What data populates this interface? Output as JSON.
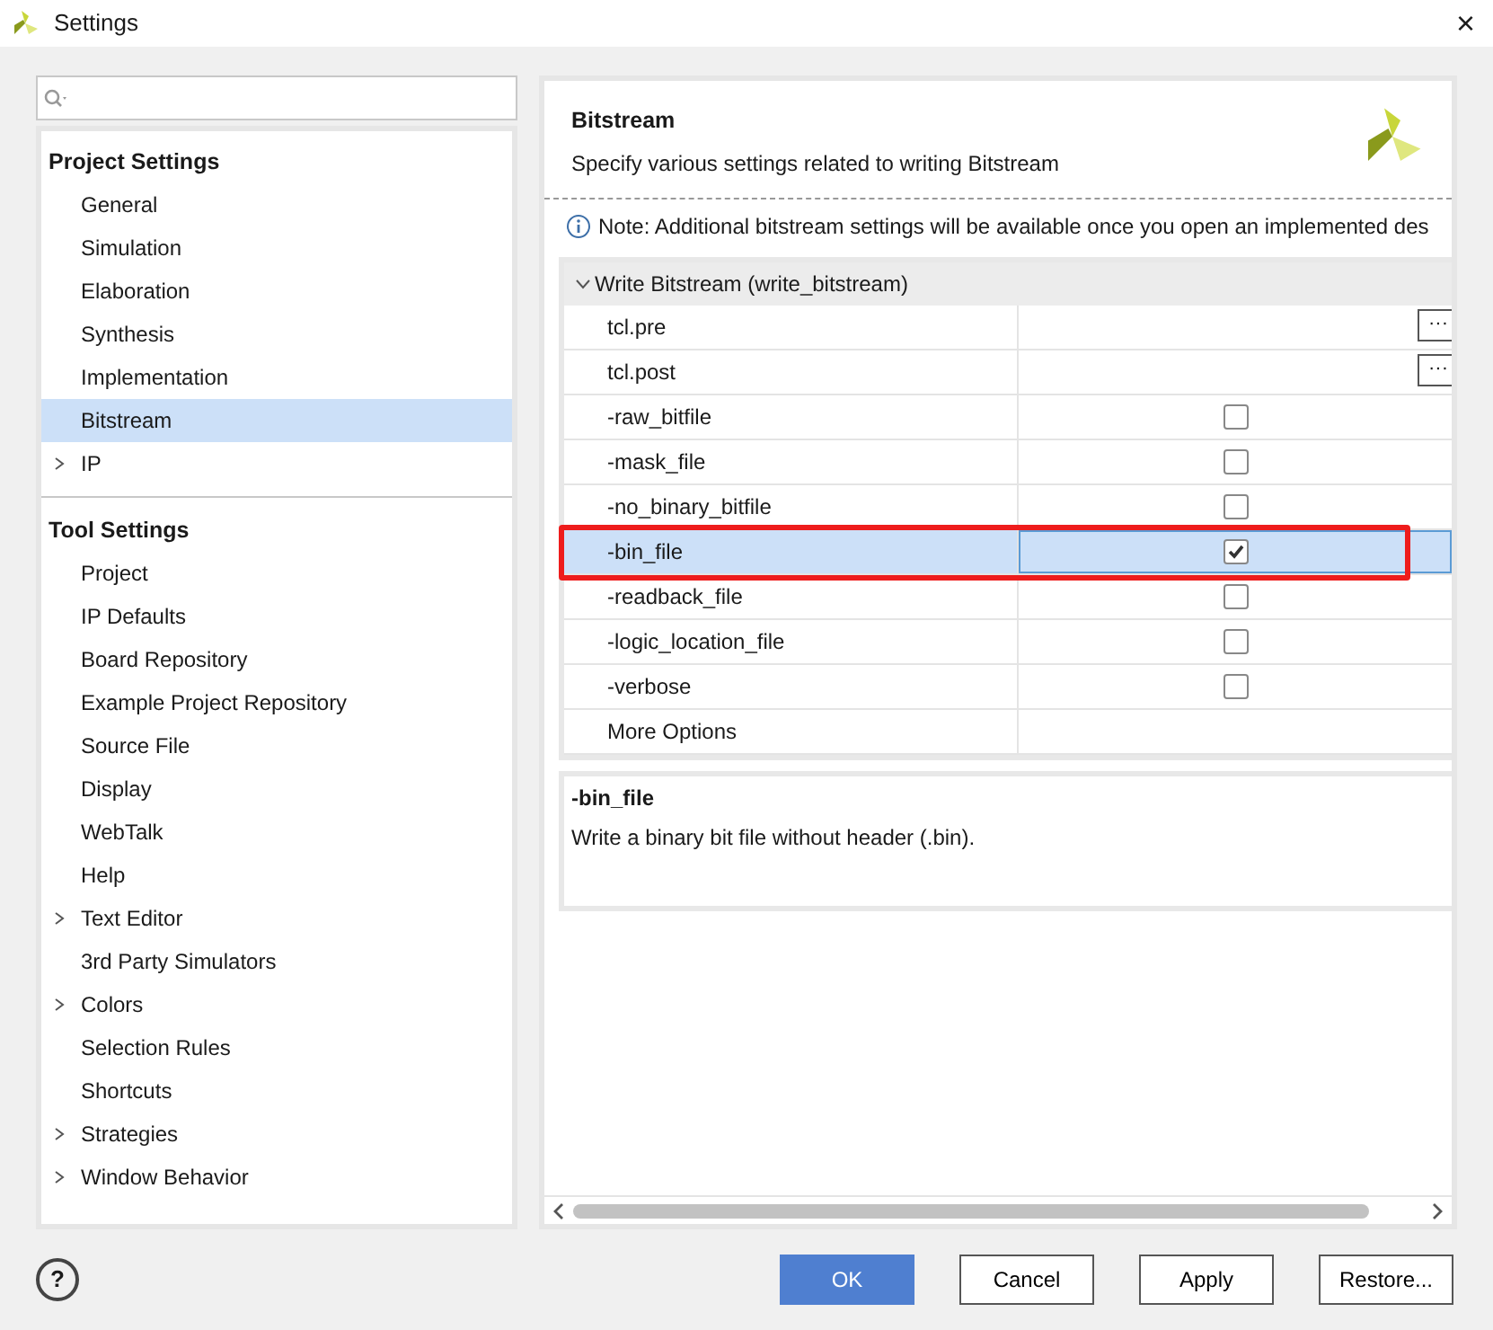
{
  "window": {
    "title": "Settings",
    "close": "×"
  },
  "sidebar": {
    "sections": [
      {
        "title": "Project Settings",
        "items": [
          {
            "label": "General",
            "selected": false
          },
          {
            "label": "Simulation",
            "selected": false
          },
          {
            "label": "Elaboration",
            "selected": false
          },
          {
            "label": "Synthesis",
            "selected": false
          },
          {
            "label": "Implementation",
            "selected": false
          },
          {
            "label": "Bitstream",
            "selected": true
          },
          {
            "label": "IP",
            "selected": false,
            "expanded": false
          }
        ]
      },
      {
        "title": "Tool Settings",
        "items": [
          {
            "label": "Project",
            "selected": false
          },
          {
            "label": "IP Defaults",
            "selected": false
          },
          {
            "label": "Board Repository",
            "selected": false
          },
          {
            "label": "Example Project Repository",
            "selected": false
          },
          {
            "label": "Source File",
            "selected": false
          },
          {
            "label": "Display",
            "selected": false
          },
          {
            "label": "WebTalk",
            "selected": false
          },
          {
            "label": "Help",
            "selected": false
          },
          {
            "label": "Text Editor",
            "selected": false,
            "expanded": false
          },
          {
            "label": "3rd Party Simulators",
            "selected": false
          },
          {
            "label": "Colors",
            "selected": false,
            "expanded": false
          },
          {
            "label": "Selection Rules",
            "selected": false
          },
          {
            "label": "Shortcuts",
            "selected": false
          },
          {
            "label": "Strategies",
            "selected": false,
            "expanded": false
          },
          {
            "label": "Window Behavior",
            "selected": false,
            "expanded": false
          }
        ]
      }
    ]
  },
  "panel": {
    "title": "Bitstream",
    "subtitle": "Specify various settings related to writing Bitstream",
    "note": "Note: Additional bitstream settings will be available once you open an implemented des",
    "group": {
      "label": "Write Bitstream (write_bitstream)",
      "expanded": true
    },
    "rows": [
      {
        "name": "tcl.pre",
        "kind": "browse",
        "button": "···",
        "selected": false
      },
      {
        "name": "tcl.post",
        "kind": "browse",
        "button": "···",
        "selected": false
      },
      {
        "name": "-raw_bitfile",
        "kind": "checkbox",
        "checked": false,
        "selected": false
      },
      {
        "name": "-mask_file",
        "kind": "checkbox",
        "checked": false,
        "selected": false
      },
      {
        "name": "-no_binary_bitfile",
        "kind": "checkbox",
        "checked": false,
        "selected": false
      },
      {
        "name": "-bin_file",
        "kind": "checkbox",
        "checked": true,
        "selected": true
      },
      {
        "name": "-readback_file",
        "kind": "checkbox",
        "checked": false,
        "selected": false
      },
      {
        "name": "-logic_location_file",
        "kind": "checkbox",
        "checked": false,
        "selected": false
      },
      {
        "name": "-verbose",
        "kind": "checkbox",
        "checked": false,
        "selected": false
      },
      {
        "name": "More Options",
        "kind": "text",
        "selected": false
      }
    ],
    "description": {
      "title": "-bin_file",
      "text": "Write a binary bit file without header (.bin)."
    }
  },
  "help": "?",
  "buttons": [
    {
      "label": "OK",
      "primary": true
    },
    {
      "label": "Cancel",
      "primary": false
    },
    {
      "label": "Apply",
      "primary": false
    },
    {
      "label": "Restore...",
      "primary": false
    }
  ]
}
